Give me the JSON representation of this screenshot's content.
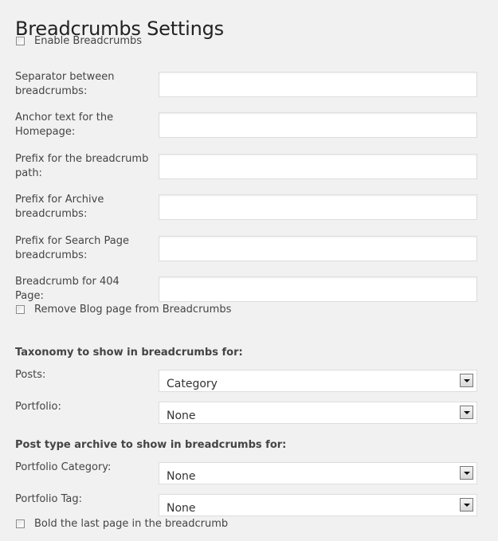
{
  "page": {
    "title": "Breadcrumbs Settings"
  },
  "checkboxes": {
    "enable": {
      "label": "Enable Breadcrumbs",
      "checked": false
    },
    "remove_blog": {
      "label": "Remove Blog page from Breadcrumbs",
      "checked": false
    },
    "bold_last": {
      "label": "Bold the last page in the breadcrumb",
      "checked": false
    }
  },
  "text_fields": [
    {
      "label_line1": "Separator between",
      "label_line2": "breadcrumbs:",
      "value": ""
    },
    {
      "label_line1": "Anchor text for the",
      "label_line2": "Homepage:",
      "value": ""
    },
    {
      "label_line1": "Prefix for the breadcrumb",
      "label_line2": "path:",
      "value": ""
    },
    {
      "label_line1": "Prefix for Archive",
      "label_line2": "breadcrumbs:",
      "value": ""
    },
    {
      "label_line1": "Prefix for Search Page",
      "label_line2": "breadcrumbs:",
      "value": ""
    },
    {
      "label_line1": "Breadcrumb for 404 Page:",
      "label_line2": "",
      "value": ""
    }
  ],
  "taxonomy_section": {
    "heading": "Taxonomy to show in breadcrumbs for:",
    "selects": [
      {
        "label": "Posts:",
        "value": "Category"
      },
      {
        "label": "Portfolio:",
        "value": "None"
      }
    ]
  },
  "archive_section": {
    "heading": "Post type archive to show in breadcrumbs for:",
    "selects": [
      {
        "label": "Portfolio Category:",
        "value": "None"
      },
      {
        "label": "Portfolio Tag:",
        "value": "None"
      }
    ]
  },
  "icons": {
    "dropdown": "chevron-down-icon"
  },
  "colors": {
    "background": "#f1f1f1",
    "text": "#444444",
    "input_border": "#dddddd"
  }
}
